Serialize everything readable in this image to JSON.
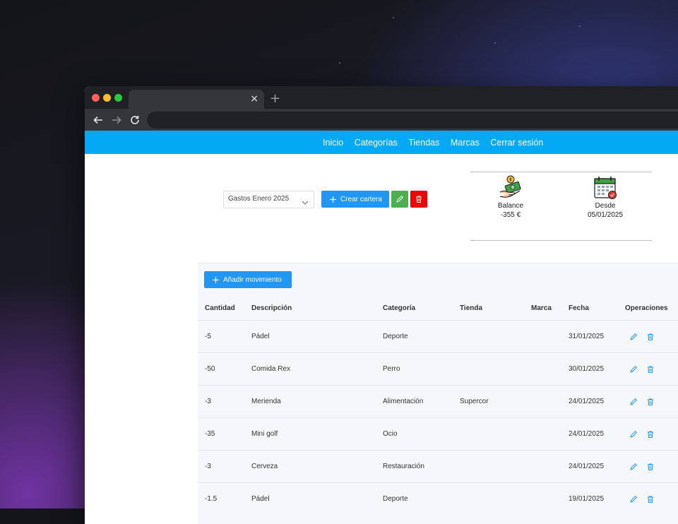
{
  "browser": {
    "tab_close_glyph": "×",
    "new_tab_glyph": "+"
  },
  "nav": {
    "links": [
      "Inicio",
      "Categorías",
      "Tiendas",
      "Marcas",
      "Cerrar sesión"
    ],
    "color": "#03a9f4"
  },
  "wallet": {
    "selected": "Gastos Enero 2025",
    "create_label": "Crear cartera",
    "edit_color": "#4caf50",
    "delete_color": "#f44336"
  },
  "stats": {
    "balance_label": "Balance",
    "balance_value": "-355 €",
    "since_label": "Desde",
    "since_value": "05/01/2025"
  },
  "movements": {
    "add_label": "Añadir movimiento",
    "columns": [
      "Cantidad",
      "Descripción",
      "Categoría",
      "Tienda",
      "Marca",
      "Fecha",
      "Operaciones"
    ],
    "rows": [
      {
        "cantidad": "-5",
        "descripcion": "Pádel",
        "categoria": "Deporte",
        "tienda": "",
        "marca": "",
        "fecha": "31/01/2025"
      },
      {
        "cantidad": "-50",
        "descripcion": "Comida Rex",
        "categoria": "Perro",
        "tienda": "",
        "marca": "",
        "fecha": "30/01/2025"
      },
      {
        "cantidad": "-3",
        "descripcion": "Merienda",
        "categoria": "Alimentación",
        "tienda": "Supercor",
        "marca": "",
        "fecha": "24/01/2025"
      },
      {
        "cantidad": "-35",
        "descripcion": "Mini golf",
        "categoria": "Ocio",
        "tienda": "",
        "marca": "",
        "fecha": "24/01/2025"
      },
      {
        "cantidad": "-3",
        "descripcion": "Cerveza",
        "categoria": "Restauración",
        "tienda": "",
        "marca": "",
        "fecha": "24/01/2025"
      },
      {
        "cantidad": "-1.5",
        "descripcion": "Pádel",
        "categoria": "Deporte",
        "tienda": "",
        "marca": "",
        "fecha": "19/01/2025"
      }
    ]
  },
  "icons": {
    "create": "plus-icon",
    "edit": "pencil-icon",
    "delete": "trash-icon",
    "balance": "money-hand-icon",
    "since": "calendar-icon"
  }
}
